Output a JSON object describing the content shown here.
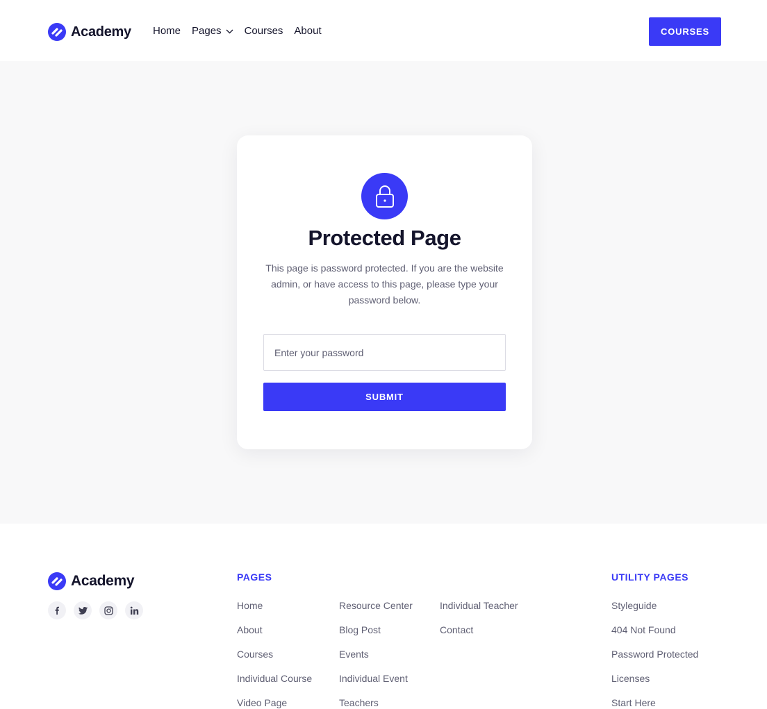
{
  "header": {
    "logo_text": "Academy",
    "nav": [
      {
        "label": "Home"
      },
      {
        "label": "Pages"
      },
      {
        "label": "Courses"
      },
      {
        "label": "About"
      }
    ],
    "cta_label": "COURSES"
  },
  "main": {
    "title": "Protected Page",
    "description": "This page is password protected. If you are the website admin, or have access to this page, please type your password below.",
    "password_placeholder": "Enter your password",
    "password_value": "",
    "submit_label": "SUBMIT"
  },
  "footer": {
    "logo_text": "Academy",
    "socials": [
      "facebook-icon",
      "twitter-icon",
      "instagram-icon",
      "linkedin-icon"
    ],
    "pages_title": "PAGES",
    "pages_col1": [
      "Home",
      "About",
      "Courses",
      "Individual Course",
      "Video Page"
    ],
    "pages_col2": [
      "Resource Center",
      "Blog Post",
      "Events",
      "Individual Event",
      "Teachers"
    ],
    "pages_col3": [
      "Individual Teacher",
      "Contact"
    ],
    "utility_title": "UTILITY PAGES",
    "utility_links": [
      "Styleguide",
      "404 Not Found",
      "Password Protected",
      "Licenses",
      "Start Here"
    ]
  },
  "colors": {
    "accent": "#3a3af6",
    "heading": "#14142b",
    "body_text": "#5f5f73",
    "page_bg": "#f8f8f9"
  }
}
